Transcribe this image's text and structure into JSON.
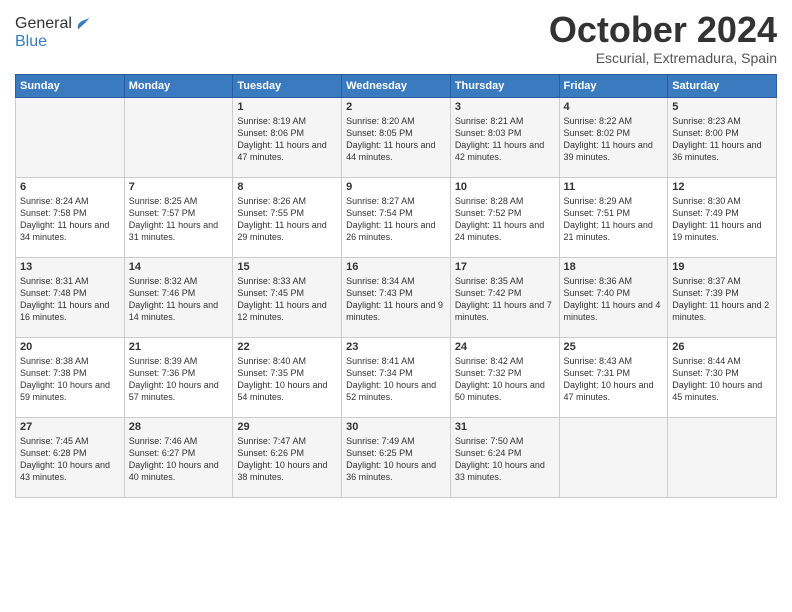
{
  "header": {
    "logo_line1": "General",
    "logo_line2": "Blue",
    "month": "October 2024",
    "location": "Escurial, Extremadura, Spain"
  },
  "weekdays": [
    "Sunday",
    "Monday",
    "Tuesday",
    "Wednesday",
    "Thursday",
    "Friday",
    "Saturday"
  ],
  "weeks": [
    [
      {
        "day": "",
        "info": ""
      },
      {
        "day": "",
        "info": ""
      },
      {
        "day": "1",
        "info": "Sunrise: 8:19 AM\nSunset: 8:06 PM\nDaylight: 11 hours and 47 minutes."
      },
      {
        "day": "2",
        "info": "Sunrise: 8:20 AM\nSunset: 8:05 PM\nDaylight: 11 hours and 44 minutes."
      },
      {
        "day": "3",
        "info": "Sunrise: 8:21 AM\nSunset: 8:03 PM\nDaylight: 11 hours and 42 minutes."
      },
      {
        "day": "4",
        "info": "Sunrise: 8:22 AM\nSunset: 8:02 PM\nDaylight: 11 hours and 39 minutes."
      },
      {
        "day": "5",
        "info": "Sunrise: 8:23 AM\nSunset: 8:00 PM\nDaylight: 11 hours and 36 minutes."
      }
    ],
    [
      {
        "day": "6",
        "info": "Sunrise: 8:24 AM\nSunset: 7:58 PM\nDaylight: 11 hours and 34 minutes."
      },
      {
        "day": "7",
        "info": "Sunrise: 8:25 AM\nSunset: 7:57 PM\nDaylight: 11 hours and 31 minutes."
      },
      {
        "day": "8",
        "info": "Sunrise: 8:26 AM\nSunset: 7:55 PM\nDaylight: 11 hours and 29 minutes."
      },
      {
        "day": "9",
        "info": "Sunrise: 8:27 AM\nSunset: 7:54 PM\nDaylight: 11 hours and 26 minutes."
      },
      {
        "day": "10",
        "info": "Sunrise: 8:28 AM\nSunset: 7:52 PM\nDaylight: 11 hours and 24 minutes."
      },
      {
        "day": "11",
        "info": "Sunrise: 8:29 AM\nSunset: 7:51 PM\nDaylight: 11 hours and 21 minutes."
      },
      {
        "day": "12",
        "info": "Sunrise: 8:30 AM\nSunset: 7:49 PM\nDaylight: 11 hours and 19 minutes."
      }
    ],
    [
      {
        "day": "13",
        "info": "Sunrise: 8:31 AM\nSunset: 7:48 PM\nDaylight: 11 hours and 16 minutes."
      },
      {
        "day": "14",
        "info": "Sunrise: 8:32 AM\nSunset: 7:46 PM\nDaylight: 11 hours and 14 minutes."
      },
      {
        "day": "15",
        "info": "Sunrise: 8:33 AM\nSunset: 7:45 PM\nDaylight: 11 hours and 12 minutes."
      },
      {
        "day": "16",
        "info": "Sunrise: 8:34 AM\nSunset: 7:43 PM\nDaylight: 11 hours and 9 minutes."
      },
      {
        "day": "17",
        "info": "Sunrise: 8:35 AM\nSunset: 7:42 PM\nDaylight: 11 hours and 7 minutes."
      },
      {
        "day": "18",
        "info": "Sunrise: 8:36 AM\nSunset: 7:40 PM\nDaylight: 11 hours and 4 minutes."
      },
      {
        "day": "19",
        "info": "Sunrise: 8:37 AM\nSunset: 7:39 PM\nDaylight: 11 hours and 2 minutes."
      }
    ],
    [
      {
        "day": "20",
        "info": "Sunrise: 8:38 AM\nSunset: 7:38 PM\nDaylight: 10 hours and 59 minutes."
      },
      {
        "day": "21",
        "info": "Sunrise: 8:39 AM\nSunset: 7:36 PM\nDaylight: 10 hours and 57 minutes."
      },
      {
        "day": "22",
        "info": "Sunrise: 8:40 AM\nSunset: 7:35 PM\nDaylight: 10 hours and 54 minutes."
      },
      {
        "day": "23",
        "info": "Sunrise: 8:41 AM\nSunset: 7:34 PM\nDaylight: 10 hours and 52 minutes."
      },
      {
        "day": "24",
        "info": "Sunrise: 8:42 AM\nSunset: 7:32 PM\nDaylight: 10 hours and 50 minutes."
      },
      {
        "day": "25",
        "info": "Sunrise: 8:43 AM\nSunset: 7:31 PM\nDaylight: 10 hours and 47 minutes."
      },
      {
        "day": "26",
        "info": "Sunrise: 8:44 AM\nSunset: 7:30 PM\nDaylight: 10 hours and 45 minutes."
      }
    ],
    [
      {
        "day": "27",
        "info": "Sunrise: 7:45 AM\nSunset: 6:28 PM\nDaylight: 10 hours and 43 minutes."
      },
      {
        "day": "28",
        "info": "Sunrise: 7:46 AM\nSunset: 6:27 PM\nDaylight: 10 hours and 40 minutes."
      },
      {
        "day": "29",
        "info": "Sunrise: 7:47 AM\nSunset: 6:26 PM\nDaylight: 10 hours and 38 minutes."
      },
      {
        "day": "30",
        "info": "Sunrise: 7:49 AM\nSunset: 6:25 PM\nDaylight: 10 hours and 36 minutes."
      },
      {
        "day": "31",
        "info": "Sunrise: 7:50 AM\nSunset: 6:24 PM\nDaylight: 10 hours and 33 minutes."
      },
      {
        "day": "",
        "info": ""
      },
      {
        "day": "",
        "info": ""
      }
    ]
  ]
}
